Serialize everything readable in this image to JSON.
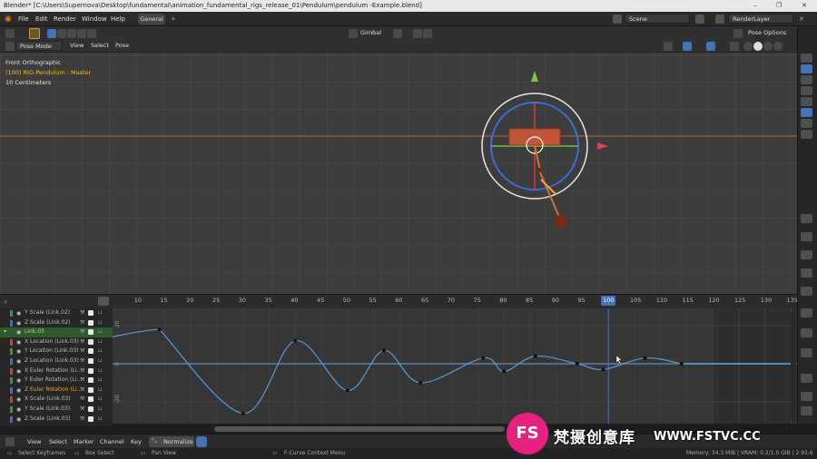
{
  "window": {
    "title": "Blender* [C:\\Users\\Supernova\\Desktop\\fundamental\\animation_fundamental_rigs_release_01\\Pendulum\\pendulum -Example.blend]"
  },
  "menu": {
    "items": [
      "File",
      "Edit",
      "Render",
      "Window",
      "Help"
    ],
    "workspace_tab": "General",
    "scene": "Scene",
    "render_layer": "RenderLayer"
  },
  "viewport_header": {
    "mode": "Pose Mode",
    "menus": [
      "View",
      "Select",
      "Pose"
    ],
    "orientation": "Gimbal",
    "pose_options": "Pose Options"
  },
  "viewport_info": {
    "view_name": "Front Orthographic",
    "object": "(100) RIG-Pendulum : Master",
    "scale": "10 Centimeters"
  },
  "timeline": {
    "frames": [
      "10",
      "15",
      "20",
      "25",
      "30",
      "35",
      "40",
      "45",
      "50",
      "55",
      "60",
      "65",
      "70",
      "75",
      "80",
      "85",
      "90",
      "95",
      "100",
      "105",
      "110",
      "115",
      "120",
      "125",
      "130",
      "135"
    ],
    "current_frame": "100"
  },
  "y_axis_labels": [
    "20",
    "0",
    "-20",
    "-40"
  ],
  "channels": [
    {
      "label": "Y Scale (Link.02)",
      "color": "#3a9a3a"
    },
    {
      "label": "Z Scale (Link.02)",
      "color": "#3b6fd6"
    },
    {
      "label": "Link.03",
      "color": "",
      "group": true
    },
    {
      "label": "X Location (Link.03)",
      "color": "#d63b3b"
    },
    {
      "label": "Y Location (Link.03)",
      "color": "#3a9a3a"
    },
    {
      "label": "Z Location (Link.03)",
      "color": "#3b6fd6"
    },
    {
      "label": "X Euler Rotation (Li...",
      "color": "#d63b3b"
    },
    {
      "label": "Y Euler Rotation (Li...",
      "color": "#3a9a3a"
    },
    {
      "label": "Z Euler Rotation (Li...",
      "color": "#3b6fd6",
      "highlight": true
    },
    {
      "label": "X Scale (Link.03)",
      "color": "#d63b3b"
    },
    {
      "label": "Y Scale (Link.03)",
      "color": "#3a9a3a"
    },
    {
      "label": "Z Scale (Link.03)",
      "color": "#3b6fd6"
    }
  ],
  "graph_footer": {
    "menus": [
      "View",
      "Select",
      "Marker",
      "Channel",
      "Key"
    ],
    "normalize": "Normalize"
  },
  "statusbar": {
    "select_keyframes": "Select Keyframes",
    "box_select": "Box Select",
    "pan_view": "Pan View",
    "context_menu": "F-Curve Context Menu",
    "memory": "Memory: 34.3 MiB | VRAM: 0.2/1.0 GiB | 2.93.6"
  },
  "watermark": {
    "logo": "FS",
    "text": "梵摄创意库",
    "url": "WWW.FSTVC.CC"
  },
  "colors": {
    "accent": "#4772b3",
    "curve": "#5b9bd5",
    "active_channel": "#2f5a2f",
    "bone": "#c0553a"
  },
  "chart_data": {
    "type": "line",
    "title": "",
    "xlabel": "",
    "ylabel": "",
    "x": [
      14,
      30,
      40,
      50,
      57,
      64,
      76,
      80,
      86,
      94,
      99,
      107,
      114
    ],
    "series": [
      {
        "values": [
          18,
          -26,
          12,
          -14,
          7,
          -10,
          3,
          -4,
          4,
          0,
          -3,
          3,
          0
        ]
      }
    ],
    "xlim": [
      5,
      140
    ],
    "ylim": [
      -30,
      25
    ]
  }
}
